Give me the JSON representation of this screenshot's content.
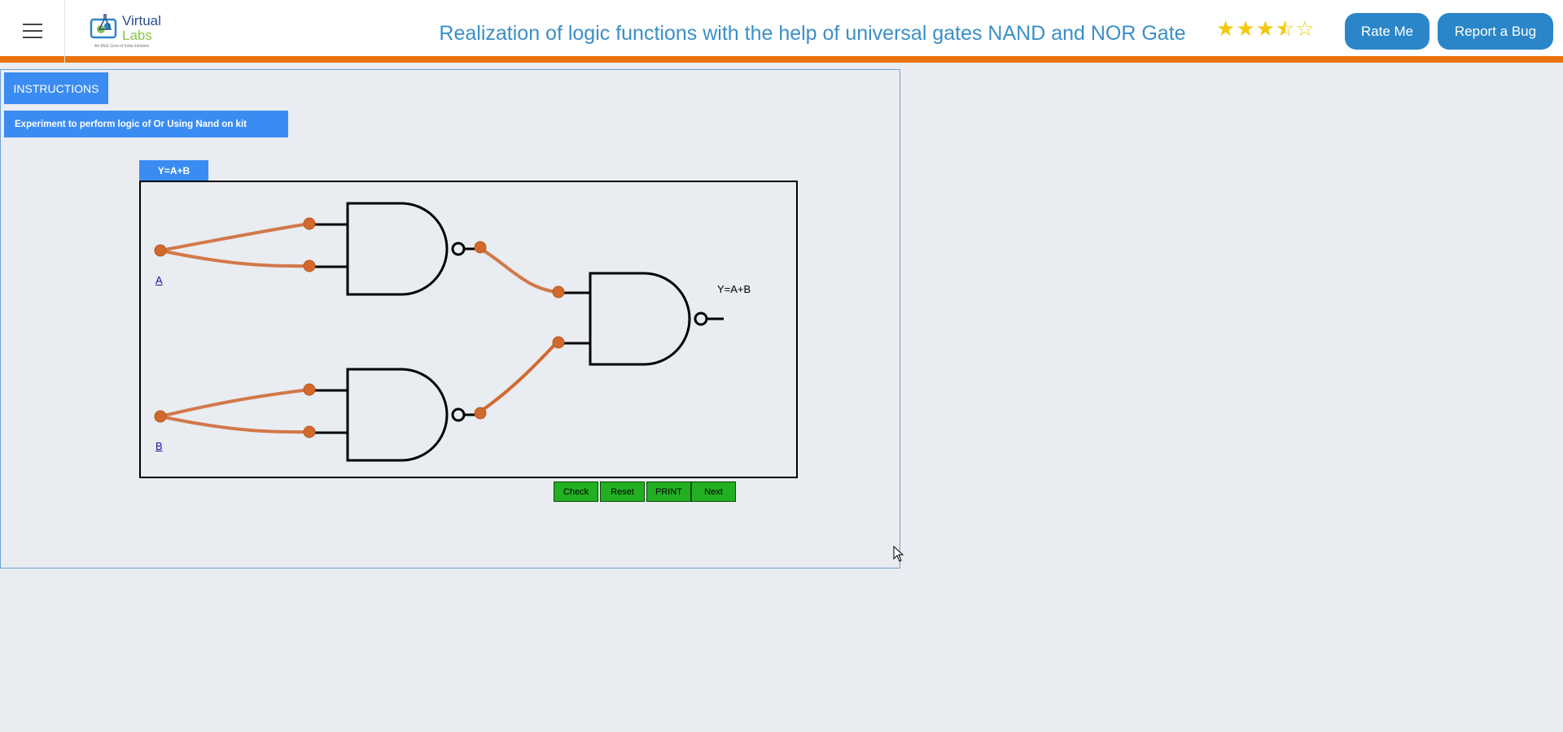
{
  "header": {
    "logo_line1": "Virtual",
    "logo_line2": "Labs",
    "logo_tagline": "An MoE Govt of India Initiative",
    "title": "Realization of logic functions with the help of universal gates NAND and NOR Gate",
    "rating": 3.5,
    "rating_max": 5,
    "rate_label": "Rate Me",
    "bug_label": "Report a Bug",
    "accent_color": "#e8720c",
    "title_color": "#3a8fc8"
  },
  "sim": {
    "instructions_label": "INSTRUCTIONS",
    "experiment_label": "Experiment to perform logic of Or Using Nand on kit",
    "circuit_tab": "Y=A+B",
    "input_a": "A",
    "input_b": "B",
    "output_label": "Y=A+B",
    "wire_color": "#d2784a",
    "buttons": {
      "check": "Check",
      "reset": "Reset",
      "print": "PRINT",
      "next": "Next"
    }
  }
}
